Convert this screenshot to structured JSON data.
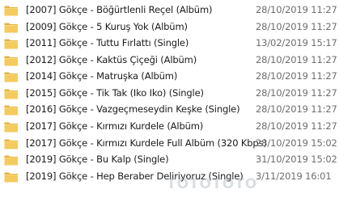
{
  "files": [
    {
      "name": "[2007] Gökçe - Böğürtlenli Reçel (Albüm)",
      "modified": "28/10/2019 11:27",
      "icon": "folder-icon"
    },
    {
      "name": "[2009] Gökçe - 5 Kuruş Yok (Albüm)",
      "modified": "28/10/2019 11:27",
      "icon": "folder-icon"
    },
    {
      "name": "[2011] Gökçe - Tuttu Fırlattı (Single)",
      "modified": "13/02/2019 15:17",
      "icon": "folder-icon"
    },
    {
      "name": "[2012] Gökçe - Kaktüs Çiçeği (Albüm)",
      "modified": "28/10/2019 11:27",
      "icon": "folder-icon"
    },
    {
      "name": "[2014] Gökçe - Matruşka (Albüm)",
      "modified": "28/10/2019 11:27",
      "icon": "folder-icon"
    },
    {
      "name": "[2015] Gökçe - Tik Tak (Iko Iko) (Single)",
      "modified": "28/10/2019 11:27",
      "icon": "folder-icon"
    },
    {
      "name": "[2016] Gökçe - Vazgeçmeseydin Keşke (Single)",
      "modified": "28/10/2019 11:27",
      "icon": "folder-icon"
    },
    {
      "name": "[2017] Gökçe - Kırmızı Kurdele (Albüm)",
      "modified": "28/10/2019 11:27",
      "icon": "folder-icon"
    },
    {
      "name": "[2017] Gökçe - Kırmızı Kurdele Full Albüm (320 Kbps)",
      "modified": "28/10/2019 15:02",
      "icon": "folder-icon"
    },
    {
      "name": "[2019] Gökçe - Bu Kalp (Single)",
      "modified": "31/10/2019 15:02",
      "icon": "folder-icon"
    },
    {
      "name": "[2019] Gökçe - Hep Beraber Deliriyoruz (Single)",
      "modified": "3/11/2019 16:01",
      "icon": "folder-icon"
    }
  ],
  "watermark": "TOTOTOTO",
  "colors": {
    "folder_body": "#f3cb5e",
    "folder_tab": "#e4b23f",
    "text": "#1a1a1a",
    "date_text": "#6d6d6d"
  }
}
